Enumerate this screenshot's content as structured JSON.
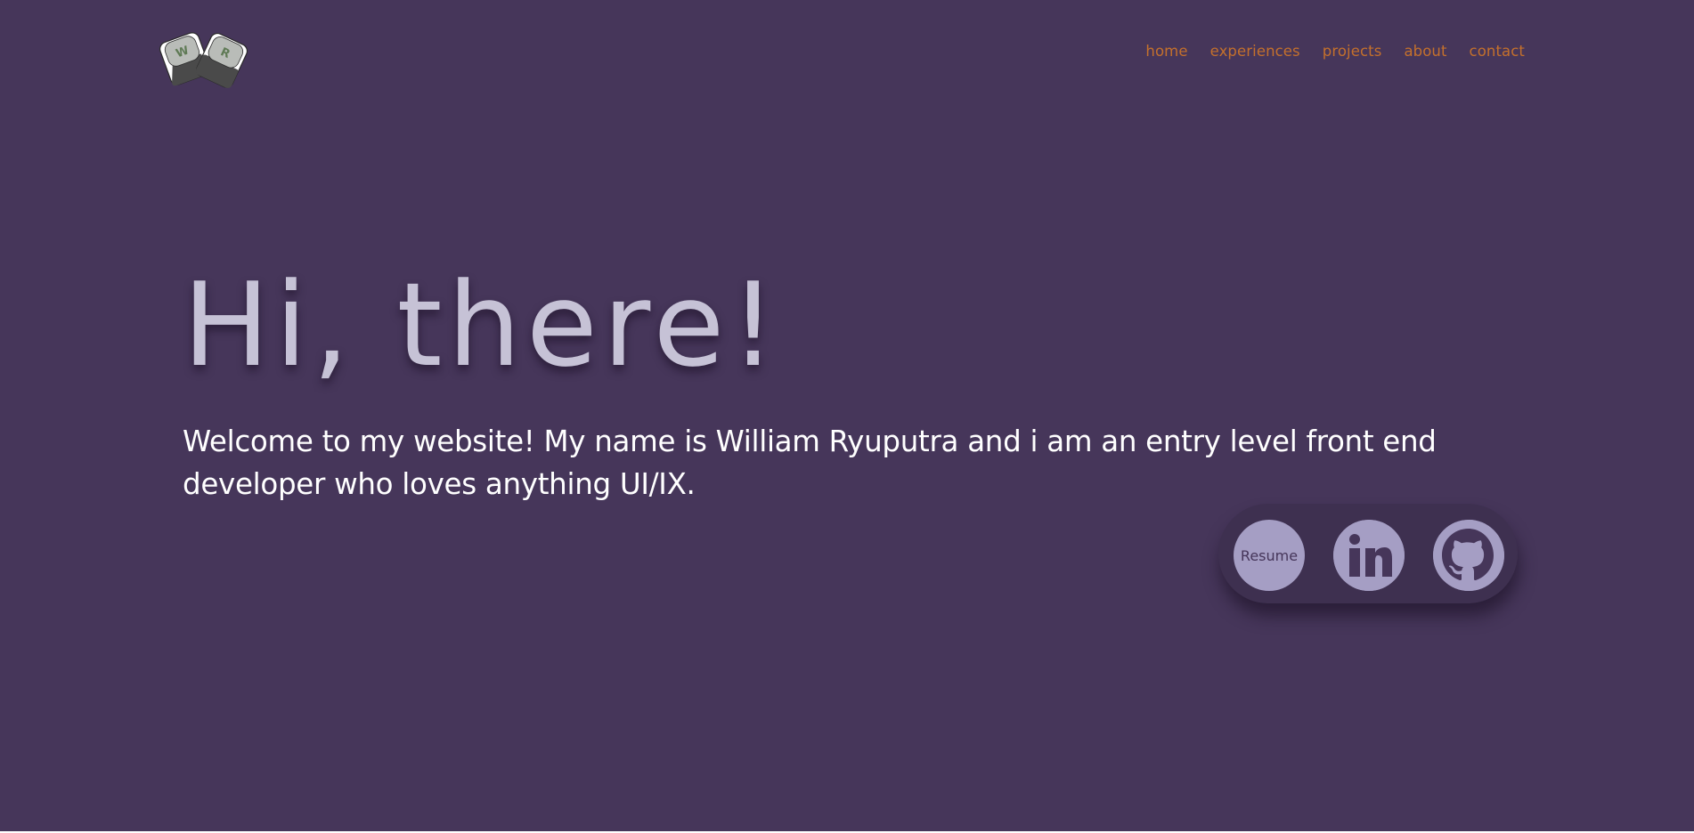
{
  "header": {
    "nav": [
      {
        "label": "home"
      },
      {
        "label": "experiences"
      },
      {
        "label": "projects"
      },
      {
        "label": "about"
      },
      {
        "label": "contact"
      }
    ]
  },
  "logo": {
    "keys": [
      "W",
      "R"
    ],
    "icon": "keycap-logo-icon"
  },
  "hero": {
    "title": "Hi, there!",
    "intro": "Welcome to my website! My name is William Ryuputra and i am an entry level front end developer who loves anything UI/IX."
  },
  "social": {
    "resume_label": "Resume",
    "linkedin_icon": "linkedin-icon",
    "github_icon": "github-icon"
  },
  "colors": {
    "background": "#46365a",
    "nav_link": "#c4702c",
    "title": "#c6c2d6",
    "intro_text": "#ffffff",
    "pill": "#3e3050",
    "circle_button": "#a59ec4"
  }
}
